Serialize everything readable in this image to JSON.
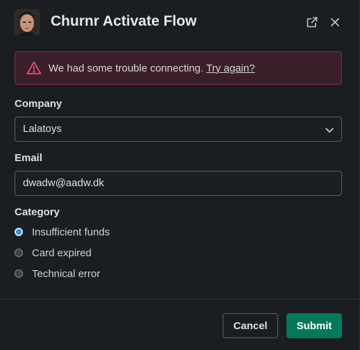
{
  "header": {
    "title": "Churnr Activate Flow",
    "avatar": "app-avatar",
    "external_icon": "external-link-icon",
    "close_icon": "close-icon"
  },
  "alert": {
    "message": "We had some trouble connecting.",
    "link_label": "Try again?",
    "icon": "warning-triangle-icon",
    "color": "#e8506f"
  },
  "company": {
    "label": "Company",
    "selected": "Lalatoys"
  },
  "email": {
    "label": "Email",
    "value": "dwadw@aadw.dk"
  },
  "category": {
    "label": "Category",
    "options": [
      {
        "label": "Insufficient funds",
        "checked": true
      },
      {
        "label": "Card expired",
        "checked": false
      },
      {
        "label": "Technical error",
        "checked": false
      }
    ]
  },
  "footer": {
    "cancel_label": "Cancel",
    "submit_label": "Submit",
    "submit_color": "#007a5a"
  }
}
